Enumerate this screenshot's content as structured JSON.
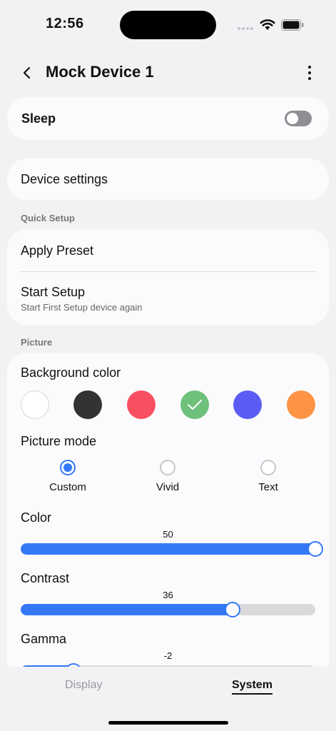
{
  "status_bar": {
    "time": "12:56"
  },
  "header": {
    "title": "Mock Device 1"
  },
  "sleep": {
    "label": "Sleep",
    "enabled": false
  },
  "device_settings": {
    "label": "Device settings"
  },
  "quick_setup": {
    "section_label": "Quick Setup",
    "apply_preset": "Apply Preset",
    "start_setup": "Start Setup",
    "start_setup_sub": "Start First Setup device again"
  },
  "picture": {
    "section_label": "Picture",
    "background_color": {
      "label": "Background color",
      "swatches": [
        "#ffffff",
        "#333333",
        "#f95061",
        "#6ec07a",
        "#5c5cf5",
        "#fd9444"
      ],
      "selected_index": 3
    },
    "picture_mode": {
      "label": "Picture mode",
      "options": [
        "Custom",
        "Vivid",
        "Text"
      ],
      "selected": "Custom"
    },
    "color": {
      "label": "Color",
      "value": "50",
      "fraction": 1.0
    },
    "contrast": {
      "label": "Contrast",
      "value": "36",
      "fraction": 0.72
    },
    "gamma": {
      "label": "Gamma",
      "value": "-2",
      "fraction": 0.18
    }
  },
  "tabs": {
    "display": "Display",
    "system": "System",
    "active": "System"
  },
  "colors": {
    "accent": "#3478f6",
    "background": "#f2f2f4",
    "card": "#fbfbfd"
  }
}
